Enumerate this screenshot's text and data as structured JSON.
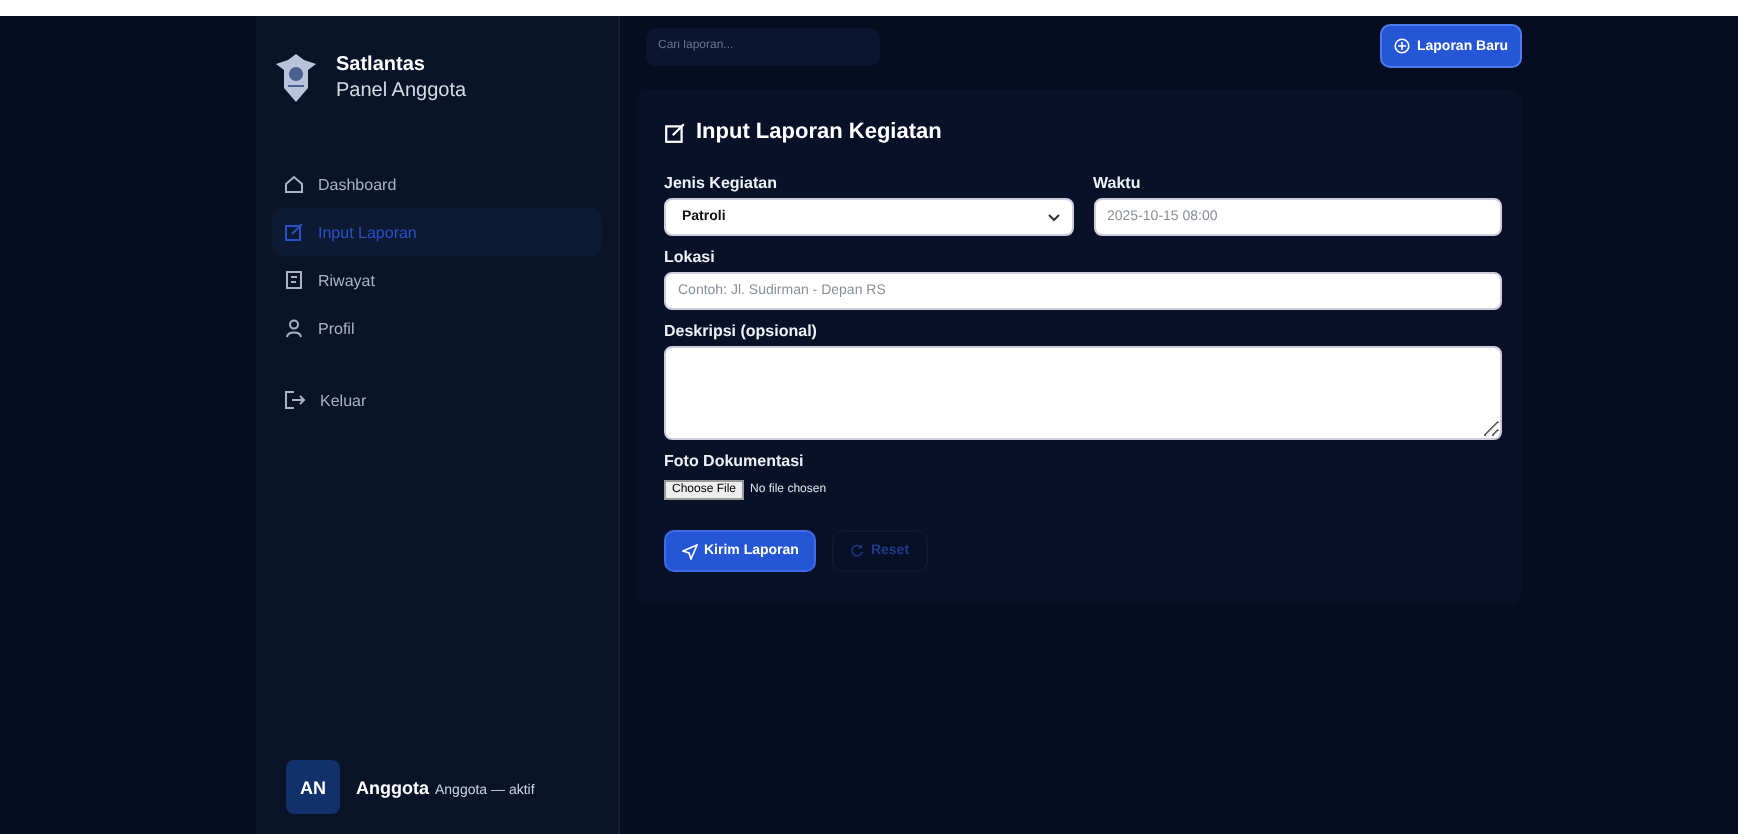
{
  "sidebar": {
    "brand": "Satlantas",
    "subtitle": "Panel Anggota",
    "items": [
      {
        "label": "Dashboard",
        "kind": "home",
        "selected": false
      },
      {
        "label": "Input Laporan",
        "kind": "edit",
        "selected": true
      },
      {
        "label": "Riwayat",
        "kind": "doc",
        "selected": false
      },
      {
        "label": "Profil",
        "kind": "user",
        "selected": false
      },
      {
        "label": "Keluar",
        "kind": "logout",
        "selected": false
      }
    ],
    "user": {
      "initials": "AN",
      "name": "Anggota",
      "status": "Anggota — aktif"
    }
  },
  "topbar": {
    "search": {
      "placeholder": "Cari laporan..."
    },
    "new_button": "Laporan Baru"
  },
  "form": {
    "title": "Input Laporan Kegiatan",
    "rows": [
      [
        {
          "kind": "select",
          "label": "Jenis Kegiatan",
          "value": "Patroli"
        },
        {
          "kind": "text",
          "label": "Waktu",
          "placeholder": "2025-10-15 08:00"
        }
      ],
      [
        {
          "kind": "text",
          "label": "Lokasi",
          "placeholder": "Contoh: Jl. Sudirman - Depan RS"
        }
      ],
      [
        {
          "kind": "textarea",
          "label": "Deskripsi (opsional)"
        }
      ],
      [
        {
          "kind": "file",
          "label": "Foto Dokumentasi",
          "button": "Choose File",
          "status": "No file chosen"
        }
      ]
    ],
    "actions": [
      {
        "kind": "primary",
        "label": "Kirim Laporan"
      },
      {
        "kind": "ghost",
        "label": "Reset"
      }
    ]
  }
}
